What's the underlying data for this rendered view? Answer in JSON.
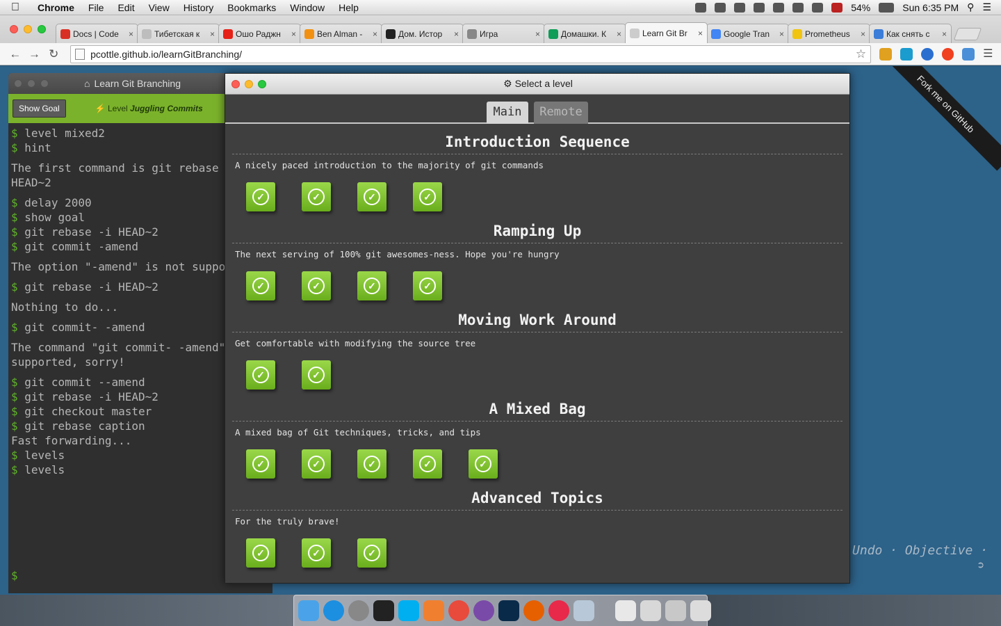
{
  "menubar": {
    "app": "Chrome",
    "items": [
      "File",
      "Edit",
      "View",
      "History",
      "Bookmarks",
      "Window",
      "Help"
    ],
    "battery": "54%",
    "clock": "Sun 6:35 PM"
  },
  "tabs": [
    {
      "title": "Docs | Code",
      "color": "#d93025"
    },
    {
      "title": "Тибетская к",
      "color": "#bdbdbd"
    },
    {
      "title": "Ошо Раджн",
      "color": "#e62117"
    },
    {
      "title": "Ben Alman -",
      "color": "#f29111"
    },
    {
      "title": "Дом. Истор",
      "color": "#222222"
    },
    {
      "title": "Игра",
      "color": "#888888"
    },
    {
      "title": "Домашки. К",
      "color": "#0f9d58"
    },
    {
      "title": "Learn Git Br",
      "color": "#cccccc",
      "active": true
    },
    {
      "title": "Google Tran",
      "color": "#4285f4"
    },
    {
      "title": "Prometheus",
      "color": "#f1c40f"
    },
    {
      "title": "Как снять с",
      "color": "#3b7dd8"
    }
  ],
  "tab_close": "×",
  "toolbar": {
    "back": "←",
    "forward": "→",
    "reload": "↻",
    "url": "pcottle.github.io/learnGitBranching/",
    "star": "☆"
  },
  "terminal": {
    "title": "Learn Git Branching",
    "show_goal": "Show Goal",
    "level_prefix": "Level",
    "level_name": "Juggling Commits",
    "lines": [
      {
        "t": "cmd",
        "text": "level mixed2"
      },
      {
        "t": "cmd",
        "text": "hint"
      },
      {
        "t": "out",
        "text": "The first command is git rebase HEAD~2"
      },
      {
        "t": "cmd",
        "text": "delay 2000"
      },
      {
        "t": "cmd",
        "text": "show goal"
      },
      {
        "t": "cmd",
        "text": "git rebase -i HEAD~2"
      },
      {
        "t": "cmd",
        "text": "git commit -amend"
      },
      {
        "t": "out",
        "text": "The option \"-amend\" is not suppo"
      },
      {
        "t": "cmd",
        "text": "git rebase -i HEAD~2"
      },
      {
        "t": "out",
        "text": "Nothing to do..."
      },
      {
        "t": "cmd",
        "text": "git commit- -amend"
      },
      {
        "t": "out",
        "text": "The command \"git commit- -amend\" supported, sorry!"
      },
      {
        "t": "cmd",
        "text": "git commit --amend"
      },
      {
        "t": "cmd",
        "text": "git rebase -i HEAD~2"
      },
      {
        "t": "cmd",
        "text": "git checkout master"
      },
      {
        "t": "cmd",
        "text": "git rebase caption"
      },
      {
        "t": "plain",
        "text": "Fast forwarding..."
      },
      {
        "t": "cmd",
        "text": "levels"
      },
      {
        "t": "cmd",
        "text": "levels"
      }
    ],
    "prompt": "$"
  },
  "modal": {
    "title": "Select a level",
    "tabs": [
      "Main",
      "Remote"
    ],
    "sequences": [
      {
        "name": "Introduction Sequence",
        "desc": "A nicely paced introduction to the majority of git commands",
        "count": 4
      },
      {
        "name": "Ramping Up",
        "desc": "The next serving of 100% git awesomes-ness. Hope you're hungry",
        "count": 4
      },
      {
        "name": "Moving Work Around",
        "desc": "Get comfortable with modifying the source tree",
        "count": 2
      },
      {
        "name": "A Mixed Bag",
        "desc": "A mixed bag of Git techniques, tricks, and tips",
        "count": 5
      },
      {
        "name": "Advanced Topics",
        "desc": "For the truly brave!",
        "count": 3
      }
    ],
    "check": "✓"
  },
  "page": {
    "ribbon": "Fork me on GitHub",
    "controls": "Undo · Objective ·"
  }
}
